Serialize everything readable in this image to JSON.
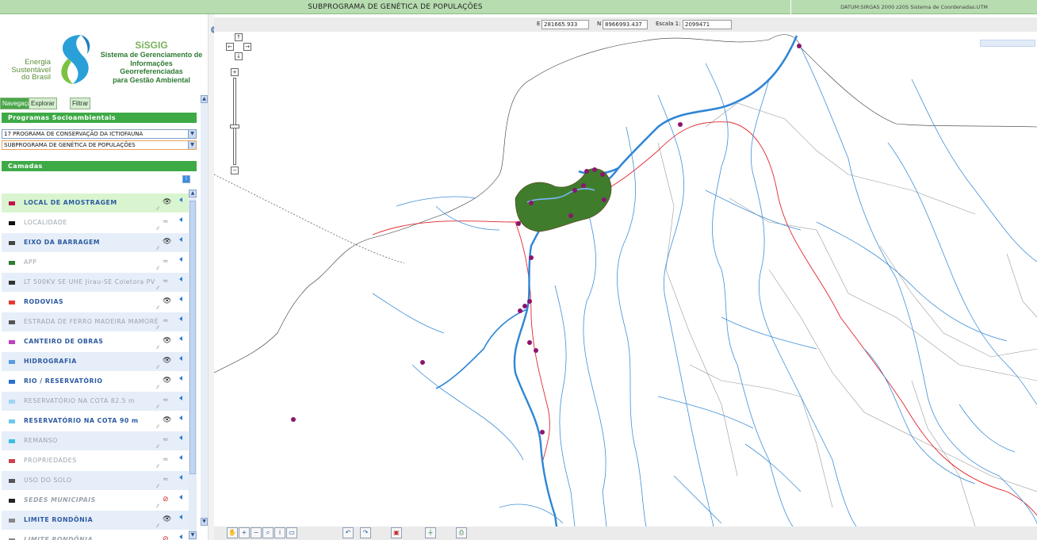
{
  "header": {
    "title": "SUBPROGRAMA DE GENÉTICA DE POPULAÇÕES",
    "datum": "DATUM:SIRGAS 2000 z20S Sistema de Coordenadas:UTM"
  },
  "logo": {
    "ees_line1": "Energia",
    "ees_line2": "Sustentável",
    "ees_line3": "do Brasil",
    "sisgig_title": "SiSGIG",
    "sisgig_line1": "Sistema de Gerenciamento de",
    "sisgig_line2": "Informações Georreferenciadas",
    "sisgig_line3": "para Gestão Ambiental"
  },
  "tabs": [
    "Navegação",
    "Explorar",
    "Filtrar"
  ],
  "programs": {
    "header": "Programas Socioambientais",
    "program_select": "17 PROGRAMA DE CONSERVAÇÃO DA ICTIOFAUNA",
    "subprogram_select": "SUBPROGRAMA DE GENÉTICA DE POPULAÇÕES"
  },
  "layers_header": "Camadas",
  "layers": [
    {
      "name": "LOCAL DE AMOSTRAGEM",
      "state": "on",
      "swatch": "#c0144a"
    },
    {
      "name": "LOCALIDADE",
      "state": "off",
      "swatch": "#111111"
    },
    {
      "name": "EIXO DA BARRAGEM",
      "state": "on",
      "swatch": "#444444"
    },
    {
      "name": "APP",
      "state": "off",
      "swatch": "#2e7d32"
    },
    {
      "name": "LT 500KV SE UHE Jirau-SE Coletora PV",
      "state": "off",
      "swatch": "#333333"
    },
    {
      "name": "RODOVIAS",
      "state": "on",
      "swatch": "#e53935"
    },
    {
      "name": "ESTRADA DE FERRO MADEIRA MAMORÉ",
      "state": "off",
      "swatch": "#555555"
    },
    {
      "name": "CANTEIRO DE OBRAS",
      "state": "on",
      "swatch": "#c040c0"
    },
    {
      "name": "HIDROGRAFIA",
      "state": "on",
      "swatch": "#5a9be0"
    },
    {
      "name": "RIO / RESERVATÓRIO",
      "state": "on",
      "swatch": "#2a6fd0"
    },
    {
      "name": "RESERVATÓRIO NA COTA 82.5 m",
      "state": "off",
      "swatch": "#9fd3f5"
    },
    {
      "name": "RESERVATÓRIO NA COTA 90 m",
      "state": "on",
      "swatch": "#6ec6f0"
    },
    {
      "name": "REMANSO",
      "state": "off",
      "swatch": "#3ac0e0"
    },
    {
      "name": "PROPRIEDADES",
      "state": "off",
      "swatch": "#d04050"
    },
    {
      "name": "USO DO SOLO",
      "state": "off",
      "swatch": "#555555"
    },
    {
      "name": "SEDES MUNICIPAIS",
      "state": "disabled",
      "swatch": "#222222"
    },
    {
      "name": "LIMITE RONDÔNIA",
      "state": "on",
      "swatch": "#888888"
    },
    {
      "name": "LIMITE RONDÔNIA",
      "state": "disabled",
      "swatch": "#888888"
    }
  ],
  "coords": {
    "e_label": "E",
    "e_value": "281665.933",
    "n_label": "N",
    "n_value": "8966993.437",
    "scale_label": "Escala 1:",
    "scale_value": "2099471"
  },
  "colors": {
    "header_green": "#b7dcb0",
    "section_green": "#3eaa46",
    "river_blue": "#2f86d6",
    "road_red": "#e0262b",
    "sample_point": "#8b1570"
  },
  "icons": {
    "toolbar": [
      "pan-hand-icon",
      "zoom-in-icon",
      "zoom-out-icon",
      "zoom-extent-icon",
      "identify-icon",
      "measure-icon",
      "undo-icon",
      "redo-icon",
      "print-icon",
      "filter-icon",
      "export-icon"
    ]
  }
}
